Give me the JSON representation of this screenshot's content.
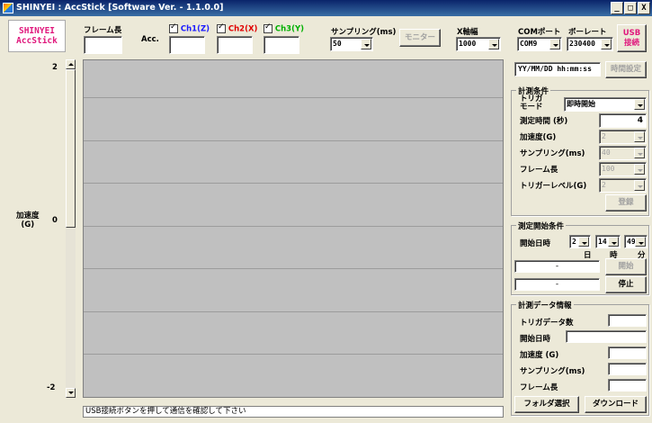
{
  "window": {
    "title": "SHINYEI : AccStick [Software Ver. - 1.1.0.0]",
    "min": "_",
    "max": "□",
    "close": "X"
  },
  "logo": {
    "line1": "SHINYEI",
    "line2": "AccStick"
  },
  "header": {
    "frame_length_label": "フレーム長",
    "acc_label": "Acc.",
    "ch1_label": "Ch1(Z)",
    "ch2_label": "Ch2(X)",
    "ch3_label": "Ch3(Y)",
    "ch_colors": {
      "ch1": "#1a1aff",
      "ch2": "#e00000",
      "ch3": "#00b000"
    },
    "sampling_label": "サンプリング(ms)",
    "sampling_value": "50",
    "monitor_button": "モニター",
    "xaxis_label": "X軸幅",
    "xaxis_value": "1000",
    "com_port_label": "COMポート",
    "com_port_value": "COM9",
    "baud_label": "ボーレート",
    "baud_value": "230400",
    "usb_button_line1": "USB",
    "usb_button_line2": "接続",
    "usb_color": "#e0197d"
  },
  "plot": {
    "y_max": "2",
    "y_zero": "0",
    "y_min": "-2",
    "ylabel_line1": "加速度",
    "ylabel_line2": "(G)"
  },
  "status_text": "USB接続ボタンを押して通信を確認して下さい",
  "time": {
    "placeholder": "YY/MM/DD hh:mm:ss",
    "set_button": "時間設定"
  },
  "conditions": {
    "title": "計測条件",
    "trigger_mode_label1": "トリガ",
    "trigger_mode_label2": "モード",
    "trigger_mode_value": "即時開始",
    "duration_label": "測定時間 (秒)",
    "duration_value": "4",
    "accel_label": "加速度(G)",
    "accel_value": "2",
    "sampling_label": "サンプリング(ms)",
    "sampling_value": "40",
    "frame_label": "フレーム長",
    "frame_value": "100",
    "trigger_level_label": "トリガーレベル(G)",
    "trigger_level_value": "2",
    "register_button": "登録"
  },
  "start": {
    "title": "測定開始条件",
    "start_datetime_label": "開始日時",
    "day_value": "2",
    "hour_value": "14",
    "minute_value": "49",
    "day_label": "日",
    "hour_label": "時",
    "minute_label": "分",
    "field1_value": "-",
    "field2_value": "-",
    "start_button": "開始",
    "stop_button": "停止"
  },
  "info": {
    "title": "計測データ情報",
    "trigger_count_label": "トリガデータ数",
    "start_datetime_label": "開始日時",
    "accel_label": "加速度 (G)",
    "sampling_label": "サンプリング(ms)",
    "frame_label": "フレーム長",
    "folder_button": "フォルダ選択",
    "download_button": "ダウンロード"
  }
}
